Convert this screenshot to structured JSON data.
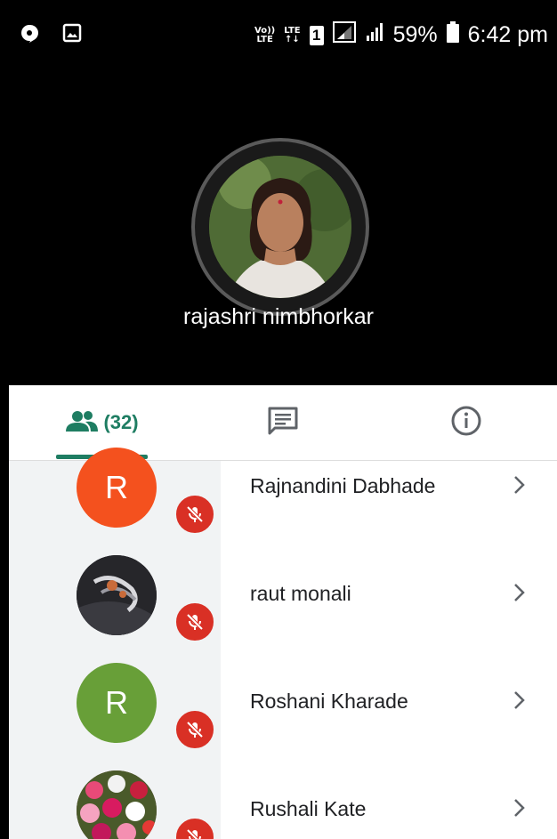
{
  "status_bar": {
    "volte_top": "Vo))",
    "volte_bottom": "LTE",
    "lte_top": "LTE",
    "lte_bottom": "↑↓",
    "sim": "1",
    "battery": "59%",
    "time": "6:42 pm"
  },
  "caller": {
    "name": "rajashri nimbhorkar"
  },
  "tabs": {
    "people_count": "(32)",
    "active": "people"
  },
  "participants": [
    {
      "name": "Rajnandini Dabhade",
      "initial": "R",
      "avatar_color": "#f4511e",
      "avatar_type": "initial",
      "muted": true
    },
    {
      "name": "raut monali",
      "initial": "",
      "avatar_color": "#222222",
      "avatar_type": "photo-jewelry",
      "muted": true
    },
    {
      "name": "Roshani Kharade",
      "initial": "R",
      "avatar_color": "#689f38",
      "avatar_type": "initial",
      "muted": true
    },
    {
      "name": "Rushali Kate",
      "initial": "",
      "avatar_color": "#7a3b4a",
      "avatar_type": "photo-flowers",
      "muted": true
    }
  ],
  "colors": {
    "accent": "#1e7d62",
    "mute": "#d93025"
  }
}
